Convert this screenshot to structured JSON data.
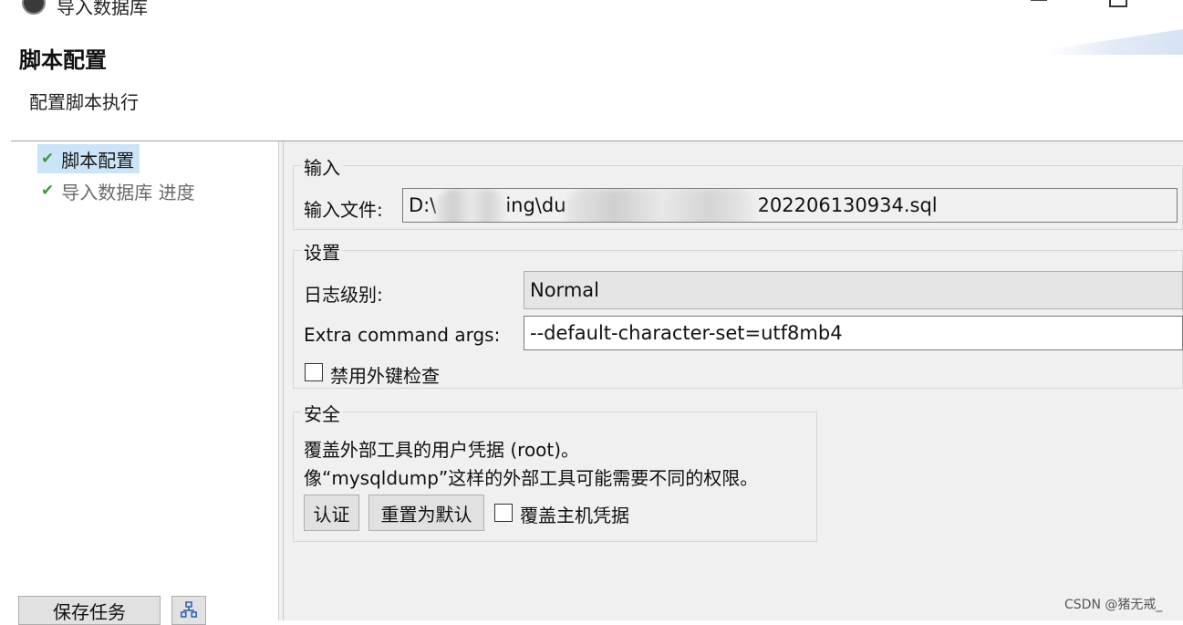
{
  "window": {
    "title": "导入数据库",
    "app_icon": "dbeaver-beaver-icon",
    "minimize_icon": "minimize-icon",
    "maximize_icon": "maximize-icon"
  },
  "header": {
    "title": "脚本配置",
    "subtitle": "配置脚本执行"
  },
  "nav": {
    "items": [
      {
        "label": "脚本配置",
        "icon": "check-icon",
        "selected": true
      },
      {
        "label": "导入数据库 进度",
        "icon": "check-icon",
        "selected": false
      }
    ]
  },
  "footer": {
    "save_task_label": "保存任务",
    "task_icon": "task-tree-icon"
  },
  "input_group": {
    "title": "输入",
    "file_label": "输入文件:",
    "file_prefix": "D:\\",
    "file_mid": "ing\\du",
    "file_suffix": "202206130934.sql"
  },
  "settings_group": {
    "title": "设置",
    "log_level_label": "日志级别:",
    "log_level_value": "Normal",
    "extra_args_label": "Extra command args:",
    "extra_args_value": "--default-character-set=utf8mb4",
    "disable_fk_label": "禁用外键检查",
    "disable_fk_checked": false
  },
  "security_group": {
    "title": "安全",
    "line1": "覆盖外部工具的用户凭据 (root)。",
    "line2": "像“mysqldump”这样的外部工具可能需要不同的权限。",
    "auth_button": "认证",
    "reset_button": "重置为默认",
    "override_host_label": "覆盖主机凭据",
    "override_host_checked": false
  },
  "watermark": "CSDN @猪无戒_",
  "colors": {
    "selection": "#cce4f7",
    "check": "#3a9c3a",
    "panel_bg": "#f0f0f0"
  }
}
